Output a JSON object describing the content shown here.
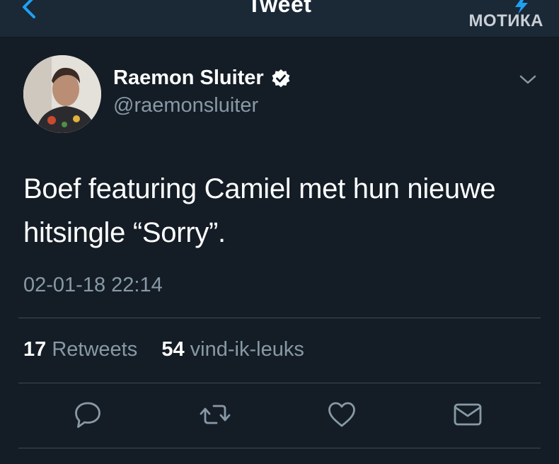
{
  "nav": {
    "title": "Tweet"
  },
  "watermark": {
    "text": "МОТИКА"
  },
  "colors": {
    "background": "#141d26",
    "navbar": "#1b2836",
    "accent": "#1da1f2",
    "secondary_text": "#8899a6",
    "divider": "#3d4a57"
  },
  "tweet": {
    "author": {
      "name": "Raemon Sluiter",
      "handle": "@raemonsluiter",
      "verified": true
    },
    "text_line1": "Boef featuring Camiel met hun nieuwe",
    "text_line2": "hitsingle “Sorry”.",
    "timestamp": "02-01-18 22:14",
    "stats": {
      "retweets_count": "17",
      "retweets_label": "Retweets",
      "likes_count": "54",
      "likes_label": "vind-ik-leuks"
    }
  },
  "icons": {
    "back": "chevron-left-icon",
    "verified": "verified-badge-icon",
    "more": "chevron-down-icon",
    "reply": "reply-icon",
    "retweet": "retweet-icon",
    "like": "heart-icon",
    "message": "mail-icon"
  }
}
